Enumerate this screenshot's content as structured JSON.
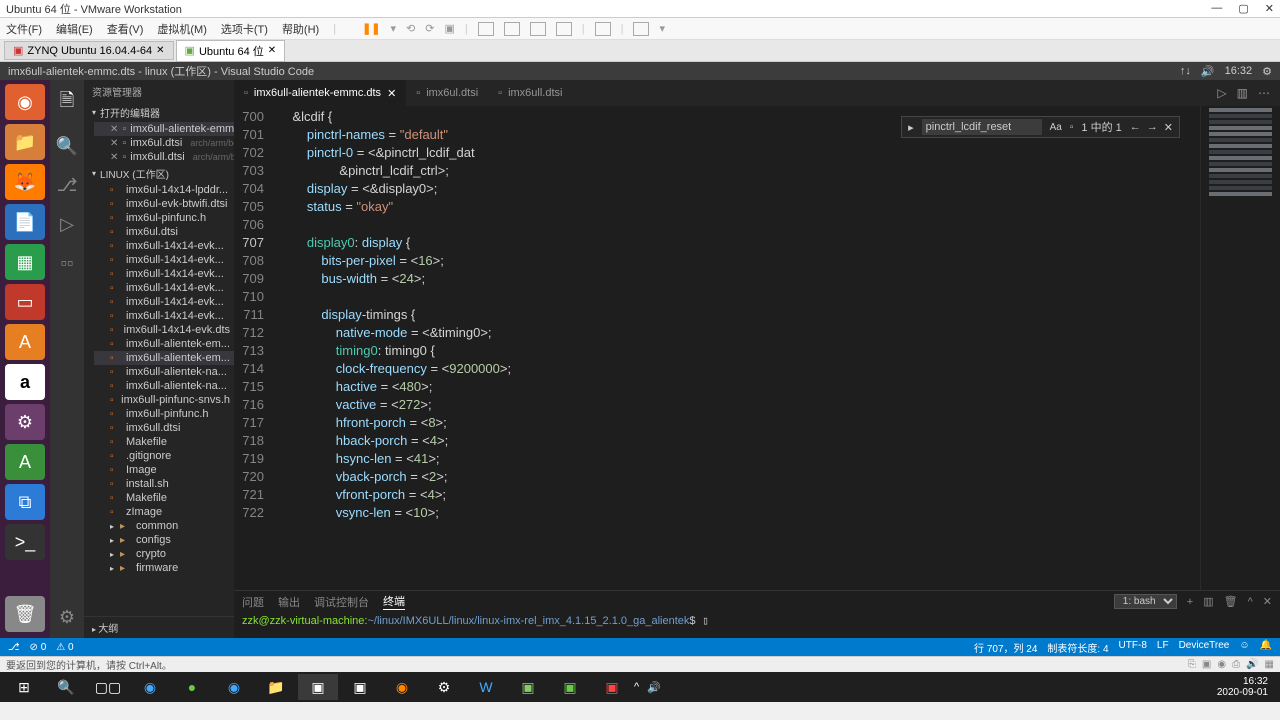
{
  "vmware": {
    "title": "Ubuntu 64 位 - VMware Workstation",
    "menu": [
      "文件(F)",
      "编辑(E)",
      "查看(V)",
      "虚拟机(M)",
      "选项卡(T)",
      "帮助(H)"
    ],
    "tabs": [
      {
        "label": "ZYNQ Ubuntu 16.04.4-64"
      },
      {
        "label": "Ubuntu 64 位"
      }
    ]
  },
  "vscode": {
    "title": "imx6ull-alientek-emmc.dts - linux (工作区) - Visual Studio Code",
    "time": "16:32",
    "sidebar_title": "资源管理器",
    "open_editors": "打开的编辑器",
    "workspace": "LINUX (工作区)",
    "outline": "大纲",
    "open_files": [
      {
        "name": "imx6ull-alientek-emmc.dts"
      },
      {
        "name": "imx6ul.dtsi",
        "meta": "arch/arm/boot/dts"
      },
      {
        "name": "imx6ull.dtsi",
        "meta": "arch/arm/boot/dts"
      }
    ],
    "tree": [
      "imx6ul-14x14-lpddr...",
      "imx6ul-evk-btwifi.dtsi",
      "imx6ul-pinfunc.h",
      "imx6ul.dtsi",
      "imx6ull-14x14-evk...",
      "imx6ull-14x14-evk...",
      "imx6ull-14x14-evk...",
      "imx6ull-14x14-evk...",
      "imx6ull-14x14-evk...",
      "imx6ull-14x14-evk...",
      "imx6ull-14x14-evk.dts",
      "imx6ull-alientek-em...",
      "imx6ull-alientek-em...",
      "imx6ull-alientek-na...",
      "imx6ull-alientek-na...",
      "imx6ull-pinfunc-snvs.h",
      "imx6ull-pinfunc.h",
      "imx6ull.dtsi",
      "Makefile",
      ".gitignore",
      "Image",
      "install.sh",
      "Makefile",
      "zImage"
    ],
    "folders": [
      "common",
      "configs",
      "crypto",
      "firmware"
    ],
    "tabs": [
      {
        "label": "imx6ull-alientek-emmc.dts",
        "active": true,
        "close": true
      },
      {
        "label": "imx6ul.dtsi"
      },
      {
        "label": "imx6ull.dtsi"
      }
    ],
    "search": {
      "value": "pinctrl_lcdif_reset",
      "count": "1 中的 1"
    },
    "lines": {
      "start": 700,
      "highlight": 707,
      "code": [
        "    &lcdif {",
        "        pinctrl-names = \"default\";",
        "        pinctrl-0 = <&pinctrl_lcdif_dat",
        "                 &pinctrl_lcdif_ctrl>;",
        "        display = <&display0>;",
        "        status = \"okay\";",
        "",
        "        display0: display {",
        "            bits-per-pixel = <16>;",
        "            bus-width = <24>;",
        "",
        "            display-timings {",
        "                native-mode = <&timing0>;",
        "                timing0: timing0 {",
        "                clock-frequency = <9200000>;",
        "                hactive = <480>;",
        "                vactive = <272>;",
        "                hfront-porch = <8>;",
        "                hback-porch = <4>;",
        "                hsync-len = <41>;",
        "                vback-porch = <2>;",
        "                vfront-porch = <4>;",
        "                vsync-len = <10>;"
      ]
    },
    "terminal": {
      "tabs": [
        "问题",
        "输出",
        "调试控制台",
        "终端"
      ],
      "active_tab": "终端",
      "shell": "1: bash",
      "prompt_user": "zzk@zzk-virtual-machine",
      "prompt_path": "~/linux/IMX6ULL/linux/linux-imx-rel_imx_4.1.15_2.1.0_ga_alientek",
      "prompt_suffix": "$"
    },
    "status": {
      "left": [
        "⎇",
        "⊘ 0",
        "⚠ 0"
      ],
      "right": [
        "行 707，列 24",
        "制表符长度: 4",
        "UTF-8",
        "LF",
        "DeviceTree",
        "☺",
        "🔔"
      ]
    }
  },
  "ubuntu_hint": "要返回到您的计算机，请按 Ctrl+Alt。",
  "windows": {
    "time": "16:32",
    "date": "2020-09-01"
  }
}
